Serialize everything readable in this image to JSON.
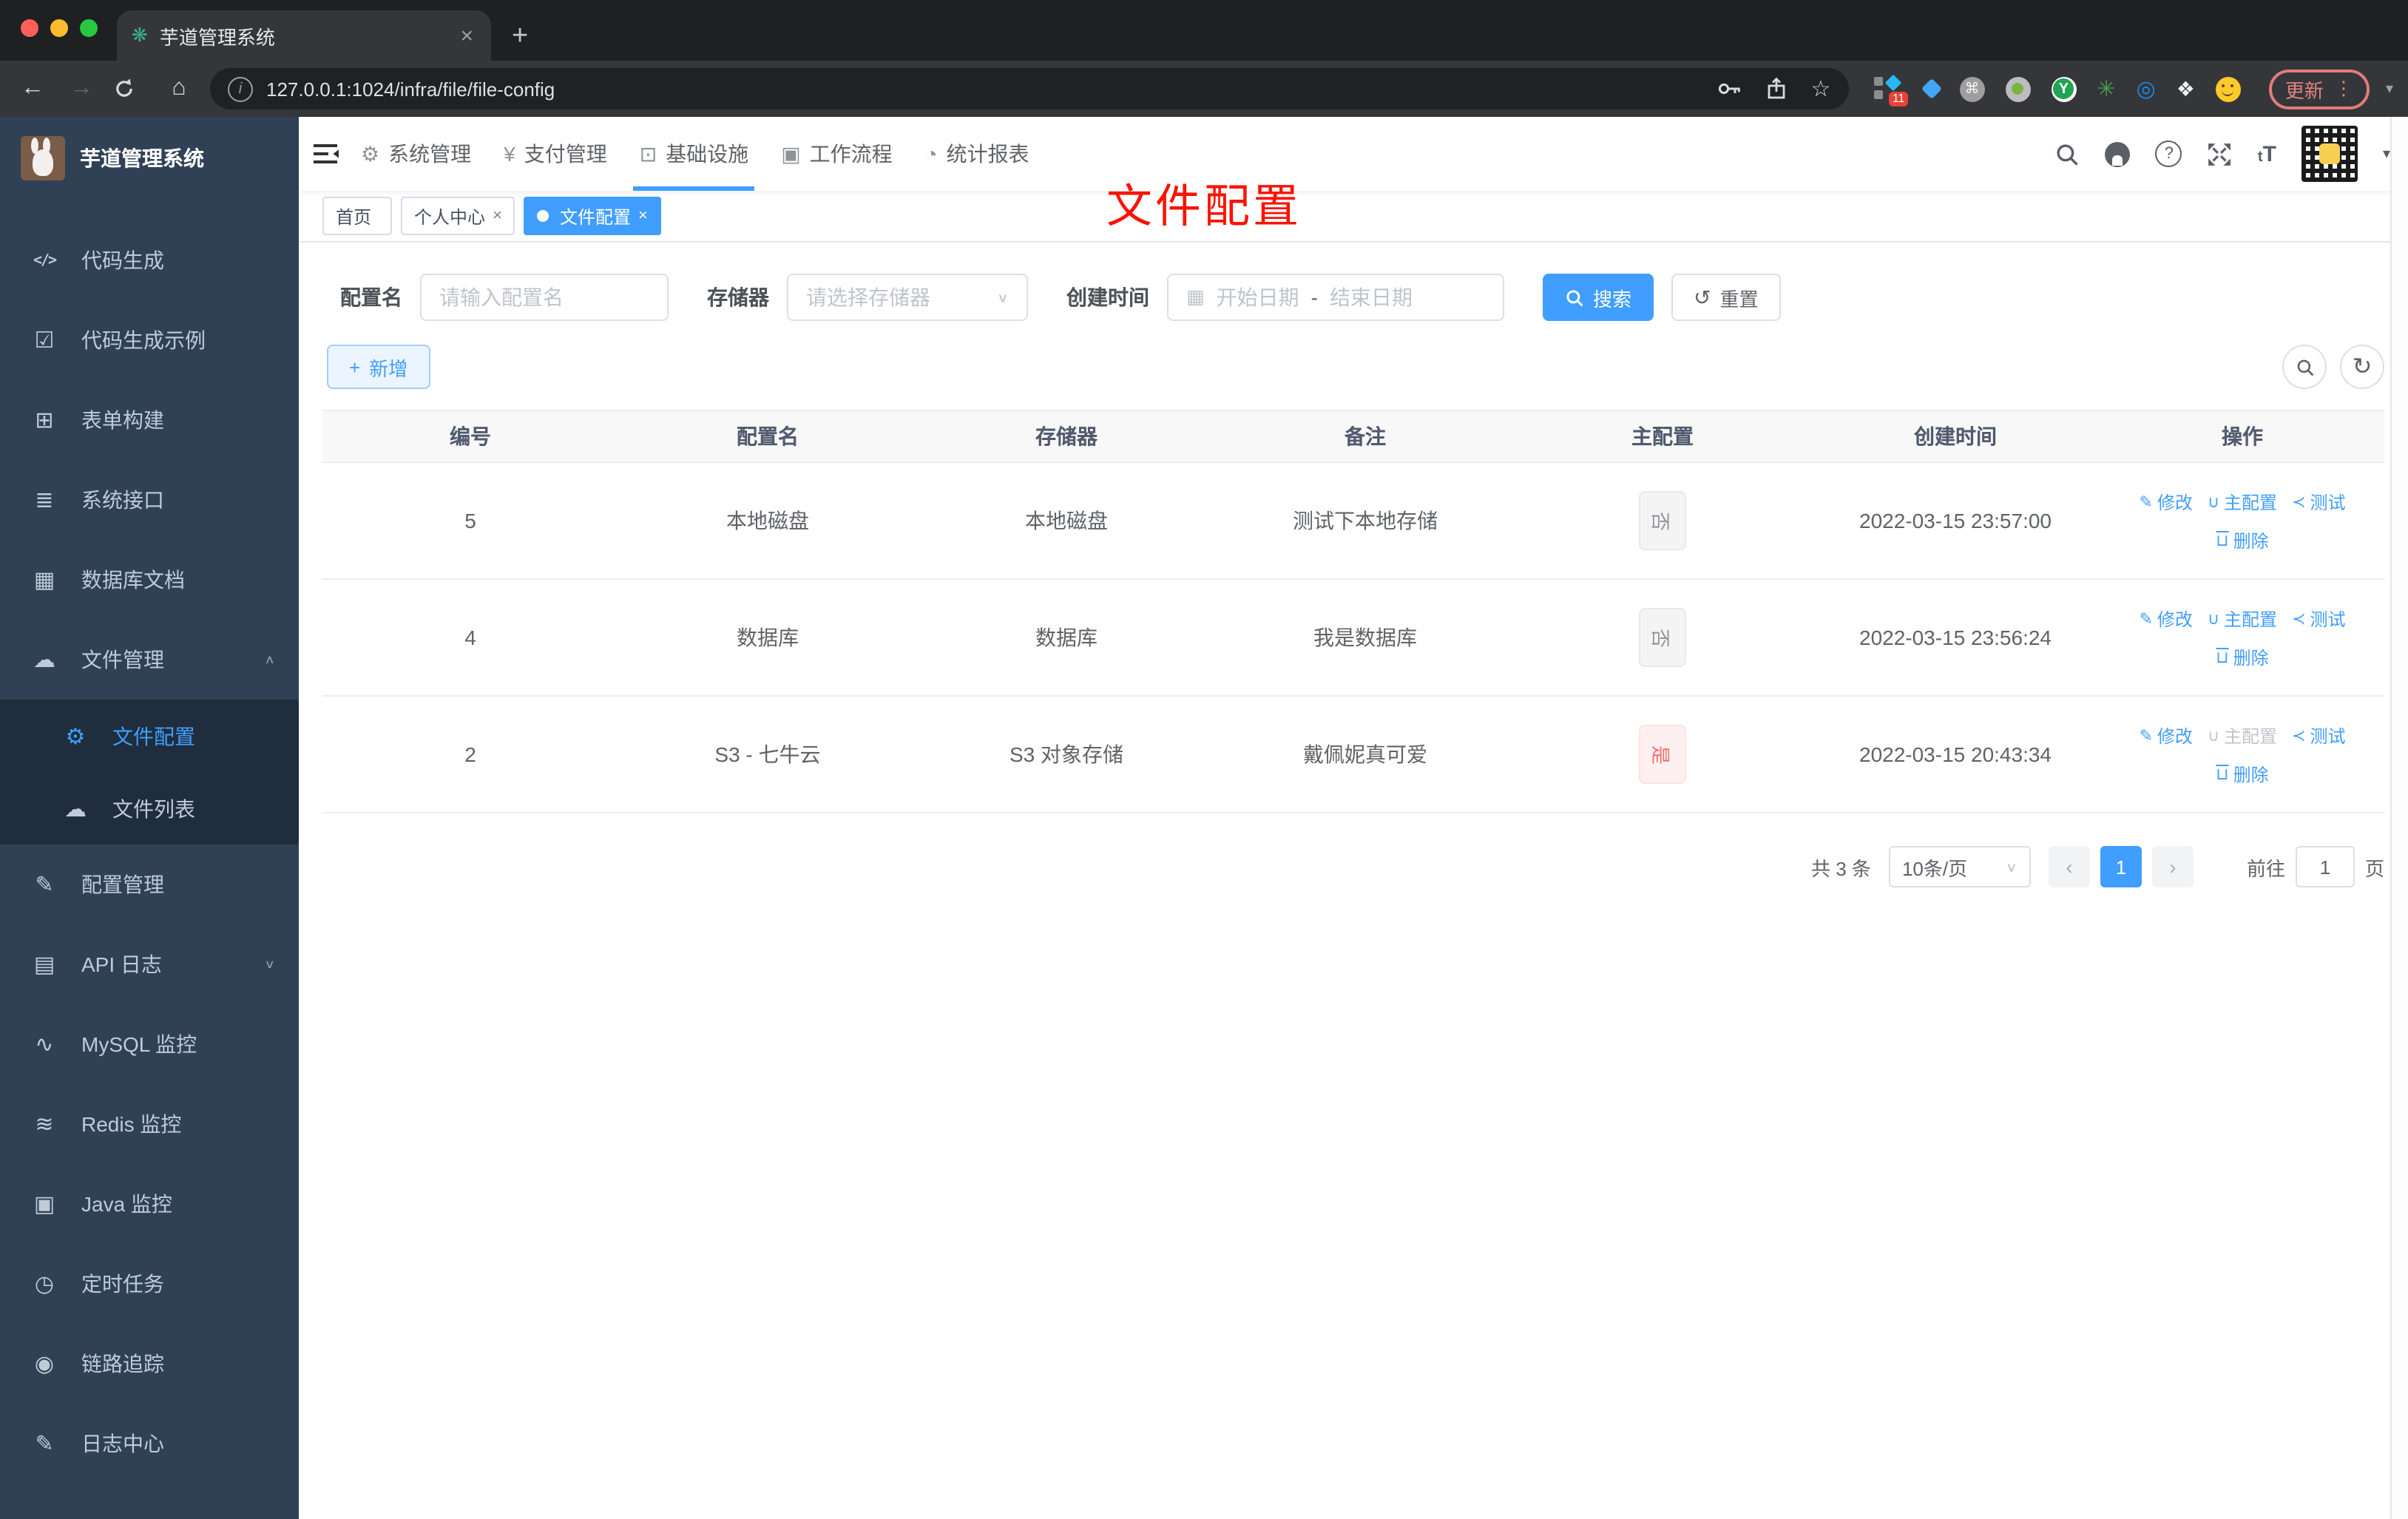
{
  "browser": {
    "tab_title": "芋道管理系统",
    "url": "127.0.0.1:1024/infra/file/file-config",
    "update_label": "更新",
    "menu_dots": "⋮",
    "extensions_badge": "11",
    "new_tab_glyph": "+",
    "close_glyph": "×"
  },
  "sidebar": {
    "title": "芋道管理系统",
    "menu_top": [
      {
        "label": "代码生成",
        "icon_name": "code-icon",
        "glyph": "</>",
        "icon_cls": "code"
      },
      {
        "label": "代码生成示例",
        "icon_name": "shield-check-icon",
        "glyph": "☑"
      },
      {
        "label": "表单构建",
        "icon_name": "form-builder-icon",
        "glyph": "⊞"
      },
      {
        "label": "系统接口",
        "icon_name": "sliders-icon",
        "glyph": "≣"
      },
      {
        "label": "数据库文档",
        "icon_name": "database-doc-icon",
        "glyph": "▦"
      },
      {
        "label": "文件管理",
        "icon_name": "cloud-download-icon",
        "glyph": "☁",
        "chevron": "∧"
      }
    ],
    "submenu": [
      {
        "label": "文件配置",
        "icon_name": "gear-icon",
        "glyph": "⚙",
        "cls": "active"
      },
      {
        "label": "文件列表",
        "icon_name": "cloud-upload-icon",
        "glyph": "☁"
      }
    ],
    "menu_bottom": [
      {
        "label": "配置管理",
        "icon_name": "edit-icon",
        "glyph": "✎"
      },
      {
        "label": "API 日志",
        "icon_name": "api-log-icon",
        "glyph": "▤",
        "chevron": "∨"
      },
      {
        "label": "MySQL 监控",
        "icon_name": "mysql-monitor-icon",
        "glyph": "∿"
      },
      {
        "label": "Redis 监控",
        "icon_name": "redis-monitor-icon",
        "glyph": "≋"
      },
      {
        "label": "Java 监控",
        "icon_name": "java-monitor-icon",
        "glyph": "▣"
      },
      {
        "label": "定时任务",
        "icon_name": "cron-job-icon",
        "glyph": "◷"
      },
      {
        "label": "链路追踪",
        "icon_name": "trace-icon",
        "glyph": "◉"
      },
      {
        "label": "日志中心",
        "icon_name": "log-center-icon",
        "glyph": "✎"
      }
    ]
  },
  "topnav": {
    "items": [
      {
        "label": "系统管理",
        "icon_name": "gear-icon",
        "glyph": "⚙"
      },
      {
        "label": "支付管理",
        "icon_name": "pay-icon",
        "glyph": "¥"
      },
      {
        "label": "基础设施",
        "icon_name": "infra-monitor-icon",
        "glyph": "⊡",
        "cls": "active"
      },
      {
        "label": "工作流程",
        "icon_name": "workflow-icon",
        "glyph": "▣"
      },
      {
        "label": "统计报表",
        "icon_name": "report-icon",
        "glyph": "◔"
      }
    ],
    "font_size_glyph": "tT"
  },
  "tags": [
    {
      "label": "首页"
    },
    {
      "label": "个人中心",
      "close": "×"
    },
    {
      "label": "文件配置",
      "close": "×",
      "cls": "active"
    }
  ],
  "annotation": {
    "text": "文件配置",
    "color": "#fe1100"
  },
  "filter": {
    "name_label": "配置名",
    "name_placeholder": "请输入配置名",
    "storage_label": "存储器",
    "storage_placeholder": "请选择存储器",
    "time_label": "创建时间",
    "start_placeholder": "开始日期",
    "range_separator": "-",
    "end_placeholder": "结束日期",
    "search_label": "搜索",
    "reset_label": "重置",
    "reset_icon_glyph": "↺",
    "calendar_icon_glyph": "▦"
  },
  "toolbar": {
    "add_label": "新增",
    "add_icon_glyph": "+",
    "refresh_icon_glyph": "↻"
  },
  "table": {
    "headers": [
      "编号",
      "配置名",
      "存储器",
      "备注",
      "主配置",
      "创建时间",
      "操作"
    ],
    "actions": {
      "edit": "修改",
      "master": "主配置",
      "test": "测试",
      "del": "删除"
    },
    "action_icons": {
      "edit": "✎",
      "master": "∪",
      "test": "≺",
      "del": "⊔"
    },
    "rows": [
      {
        "id": "5",
        "name": "本地磁盘",
        "storage": "本地磁盘",
        "remark": "测试下本地存储",
        "master_label": "否",
        "master_cls": "info",
        "master_link_cls": "",
        "created": "2022-03-15 23:57:00"
      },
      {
        "id": "4",
        "name": "数据库",
        "storage": "数据库",
        "remark": "我是数据库",
        "master_label": "否",
        "master_cls": "info",
        "master_link_cls": "",
        "created": "2022-03-15 23:56:24"
      },
      {
        "id": "2",
        "name": "S3 - 七牛云",
        "storage": "S3 对象存储",
        "remark": "戴佩妮真可爱",
        "master_label": "是",
        "master_cls": "danger",
        "master_link_cls": "disabled",
        "created": "2022-03-15 20:43:34"
      }
    ]
  },
  "pagination": {
    "total": "共 3 条",
    "page_size": "10条/页",
    "prev_glyph": "‹",
    "page": "1",
    "next_glyph": "›",
    "goto_label": "前往",
    "goto_value": "1",
    "page_unit": "页"
  },
  "colors": {
    "accent": "#409eff",
    "danger": "#f56c6c",
    "sidebar_bg": "#304156",
    "submenu_bg": "#1f2d3d",
    "annotation_red": "#fe1100",
    "tag_info_text": "#909399",
    "chrome_bg": "#35363a"
  }
}
